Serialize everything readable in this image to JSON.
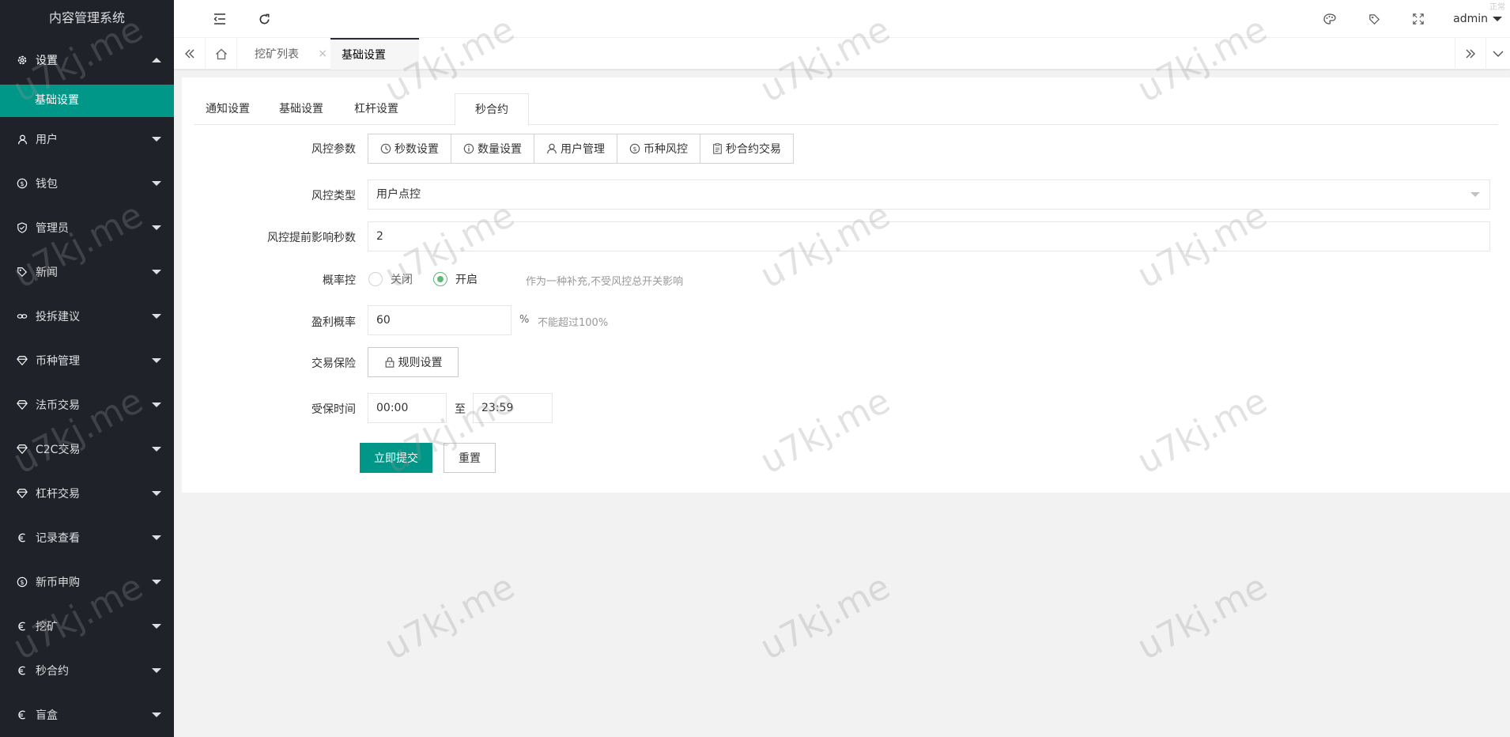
{
  "app": {
    "title": "内容管理系统"
  },
  "sidebar": {
    "items": [
      {
        "label": "设置",
        "icon": "gear-icon",
        "open": true
      },
      {
        "label": "用户",
        "icon": "user-icon"
      },
      {
        "label": "钱包",
        "icon": "dollar-icon"
      },
      {
        "label": "管理员",
        "icon": "shield-icon"
      },
      {
        "label": "新闻",
        "icon": "tag-icon"
      },
      {
        "label": "投拆建议",
        "icon": "link-icon"
      },
      {
        "label": "币种管理",
        "icon": "diamond-icon"
      },
      {
        "label": "法币交易",
        "icon": "diamond-icon"
      },
      {
        "label": "C2C交易",
        "icon": "diamond-icon"
      },
      {
        "label": "杠杆交易",
        "icon": "diamond-icon"
      },
      {
        "label": "记录查看",
        "icon": "euro-icon"
      },
      {
        "label": "新币申购",
        "icon": "dollar-icon"
      },
      {
        "label": "挖矿",
        "icon": "euro-icon"
      },
      {
        "label": "秒合约",
        "icon": "euro-icon"
      },
      {
        "label": "盲盒",
        "icon": "euro-icon"
      }
    ],
    "sub_active": "基础设置"
  },
  "header": {
    "user": "admin",
    "corner_text": "正常"
  },
  "tabbar": {
    "tabs": [
      {
        "label": "挖矿列表",
        "close": "×"
      },
      {
        "label": "基础设置"
      }
    ]
  },
  "page": {
    "tabs": [
      "通知设置",
      "基础设置",
      "杠杆设置",
      "秒合约"
    ],
    "active_tab": "秒合约",
    "risk_params_label": "风控参数",
    "risk_buttons": [
      "秒数设置",
      "数量设置",
      "用户管理",
      "币种风控",
      "秒合约交易"
    ],
    "risk_type_label": "风控类型",
    "risk_type_value": "用户点控",
    "advance_label": "风控提前影响秒数",
    "advance_value": "2",
    "prob_label": "概率控",
    "prob_off": "关闭",
    "prob_on": "开启",
    "prob_selected": "开启",
    "prob_hint": "作为一种补充,不受风控总开关影响",
    "profit_label": "盈利概率",
    "profit_value": "60",
    "profit_unit": "%",
    "profit_hint": "不能超过100%",
    "insurance_label": "交易保险",
    "insurance_button": "规则设置",
    "time_label": "受保时间",
    "time_start": "00:00",
    "time_sep": "至",
    "time_end": "23:59",
    "submit": "立即提交",
    "reset": "重置"
  },
  "watermark": {
    "text": "u7kj.me"
  }
}
